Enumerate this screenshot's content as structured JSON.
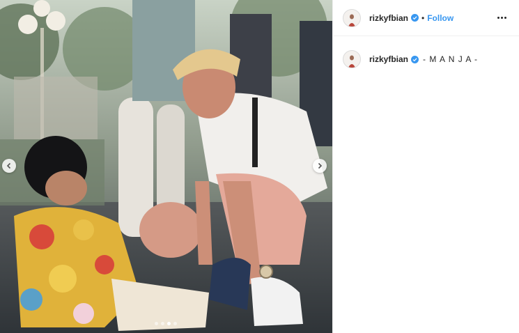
{
  "post": {
    "username": "rizkyfbian",
    "follow_label": "Follow",
    "separator": "•",
    "caption": "- M A N J A -",
    "carousel": {
      "slide_count": 4,
      "active_index": 2
    }
  },
  "colors": {
    "accent": "#3897f0",
    "text": "#262626",
    "border": "#efefef"
  },
  "icons": {
    "verified": "verified-badge-icon",
    "more": "more-options-icon",
    "prev": "chevron-left-icon",
    "next": "chevron-right-icon"
  }
}
